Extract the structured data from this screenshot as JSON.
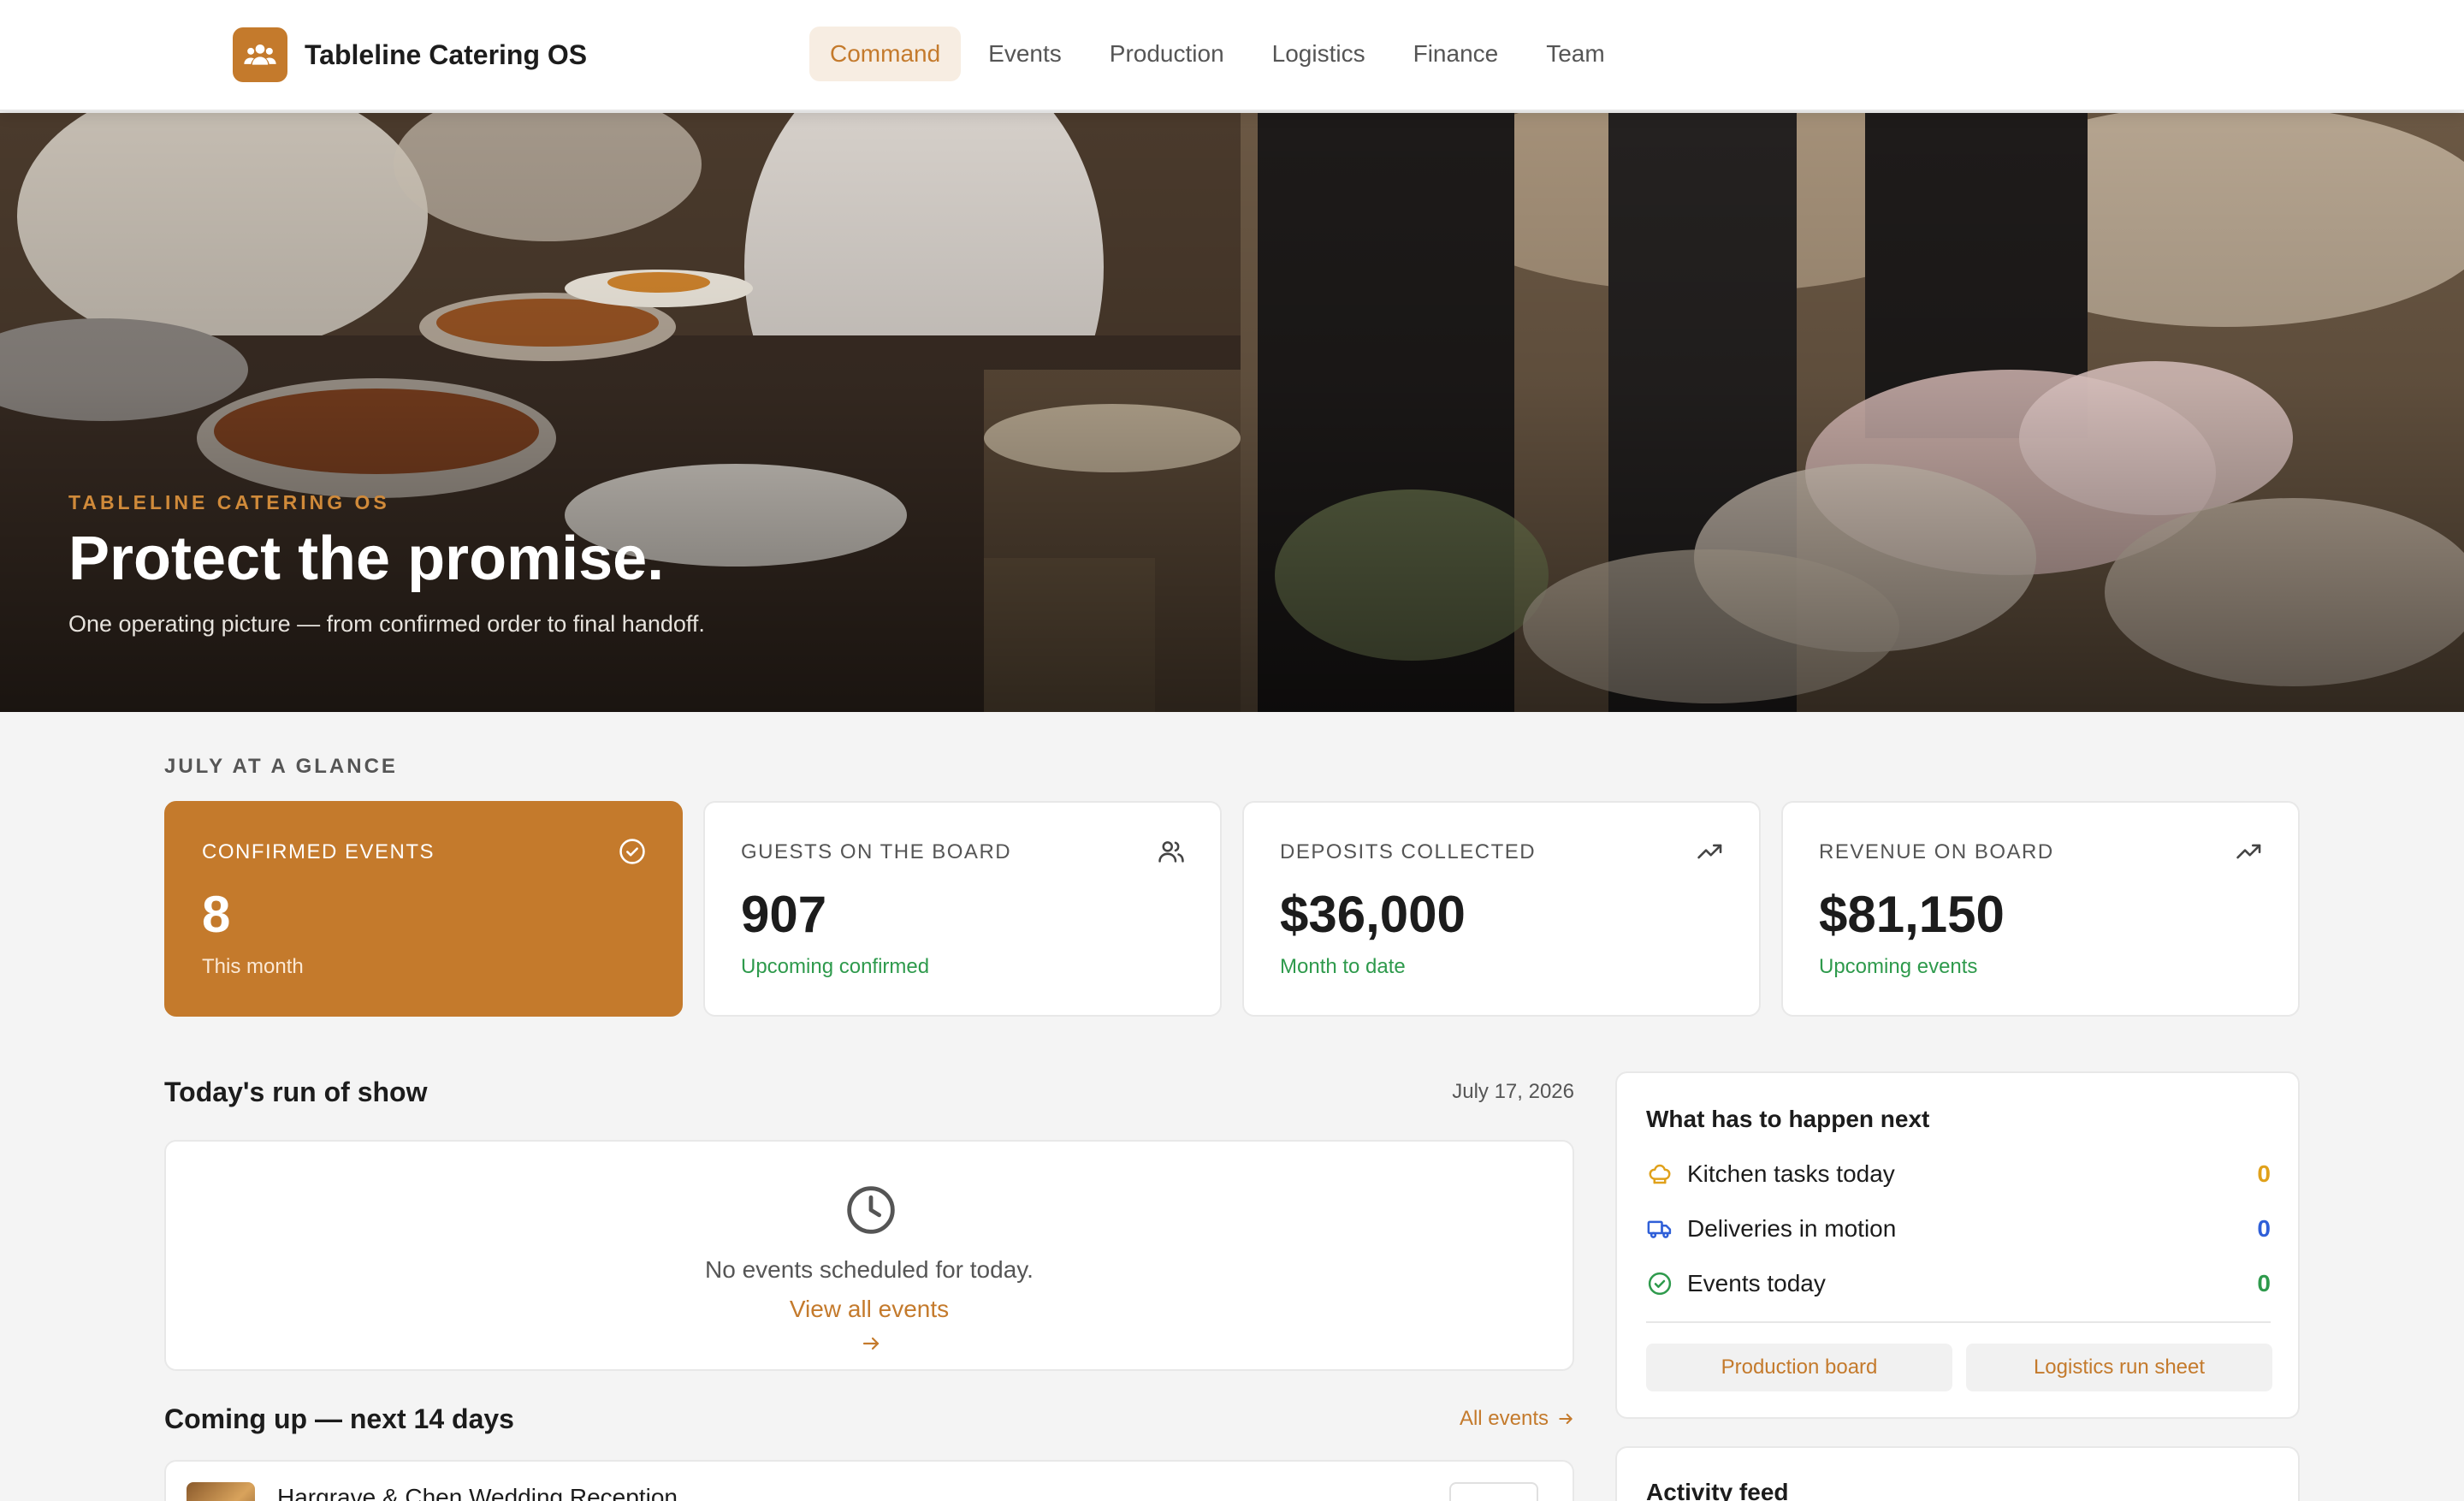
{
  "app": {
    "name": "Tableline Catering OS"
  },
  "nav": {
    "items": [
      {
        "label": "Command",
        "active": true
      },
      {
        "label": "Events",
        "active": false
      },
      {
        "label": "Production",
        "active": false
      },
      {
        "label": "Logistics",
        "active": false
      },
      {
        "label": "Finance",
        "active": false
      },
      {
        "label": "Team",
        "active": false
      }
    ]
  },
  "hero": {
    "eyebrow": "TABLELINE CATERING OS",
    "title": "Protect the promise.",
    "subtitle": "One operating picture — from confirmed order to final handoff."
  },
  "glance": {
    "label": "JULY AT A GLANCE",
    "cards": [
      {
        "label": "CONFIRMED EVENTS",
        "value": "8",
        "note": "This month",
        "icon": "check-circle-icon"
      },
      {
        "label": "GUESTS ON THE BOARD",
        "value": "907",
        "note": "Upcoming confirmed",
        "icon": "users-icon"
      },
      {
        "label": "DEPOSITS COLLECTED",
        "value": "$36,000",
        "note": "Month to date",
        "icon": "trending-up-icon"
      },
      {
        "label": "REVENUE ON BOARD",
        "value": "$81,150",
        "note": "Upcoming events",
        "icon": "trending-up-icon"
      }
    ]
  },
  "run_of_show": {
    "title": "Today's run of show",
    "date": "July 17, 2026",
    "empty_text": "No events scheduled for today.",
    "view_all": "View all events"
  },
  "coming_up": {
    "title": "Coming up — next 14 days",
    "all_events": "All events",
    "events": [
      {
        "title": "Hargrave & Chen Wedding Reception"
      }
    ]
  },
  "next": {
    "title": "What has to happen next",
    "rows": [
      {
        "label": "Kitchen tasks today",
        "count": "0",
        "color": "#e0a11b",
        "icon": "chef-hat-icon"
      },
      {
        "label": "Deliveries in motion",
        "count": "0",
        "color": "#2f5fd8",
        "icon": "truck-icon"
      },
      {
        "label": "Events today",
        "count": "0",
        "color": "#2e9a4c",
        "icon": "check-circle-icon"
      }
    ],
    "buttons": [
      "Production board",
      "Logistics run sheet"
    ]
  },
  "feed": {
    "title": "Activity feed"
  },
  "colors": {
    "accent": "#c47a2c",
    "positive": "#2e9a4c",
    "warning": "#e0a11b",
    "info": "#2f5fd8"
  }
}
